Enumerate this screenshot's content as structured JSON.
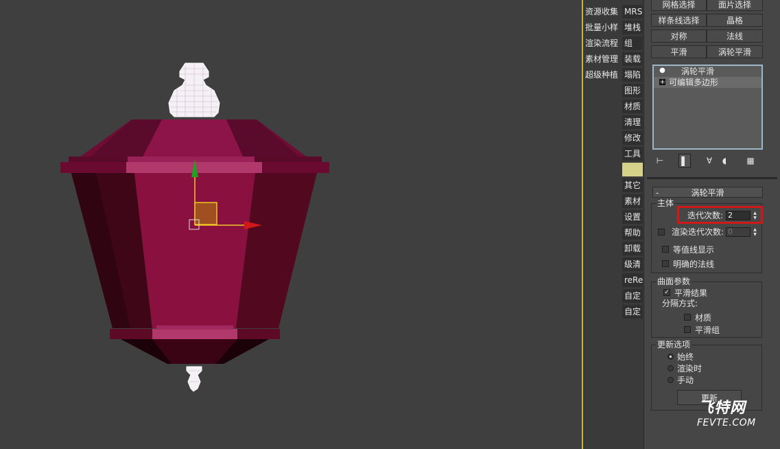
{
  "colors": {
    "viewport_bg": "#3f3f3f",
    "panel_bg": "#464646",
    "accent_highlight": "#d01818",
    "lamp_main": "#8a1040",
    "lamp_dark": "#4a0820",
    "lamp_light": "#b03060",
    "gizmo_x": "#d01818",
    "gizmo_y": "#20a020",
    "gizmo_center": "#a05020",
    "mesh_white": "#ffffff"
  },
  "script_menu": {
    "items": [
      "资源收集",
      "批量小样",
      "渲染流程",
      "素材管理",
      "超级种植"
    ]
  },
  "tool_menu": {
    "items": [
      "MRS",
      "堆栈",
      "组",
      "装载",
      "塌陷",
      "图形",
      "材质",
      "清理",
      "修改",
      "工具",
      "",
      "其它",
      "素材",
      "设置",
      "帮助",
      "卸载",
      "级清",
      "reRe",
      "自定",
      "自定"
    ]
  },
  "modifier_buttons": [
    [
      "网格选择",
      "面片选择"
    ],
    [
      "样条线选择",
      "晶格"
    ],
    [
      "对称",
      "法线"
    ],
    [
      "平滑",
      "涡轮平滑"
    ]
  ],
  "modifier_stack": {
    "items": [
      {
        "label": "涡轮平滑",
        "icon": "lightbulb-icon"
      },
      {
        "label": "可编辑多边形",
        "icon": "plus-box-icon"
      }
    ]
  },
  "stack_toolbar": {
    "icons": [
      "pin-stack-icon",
      "show-end-result-icon",
      "make-unique-icon",
      "remove-modifier-icon",
      "configure-sets-icon"
    ]
  },
  "rollout": {
    "title": "涡轮平滑",
    "collapse_symbol": "-",
    "main_group": {
      "title": "主体",
      "iterations_label": "迭代次数:",
      "iterations_value": "2",
      "render_iters_label": "渲染迭代次数:",
      "render_iters_value": "0",
      "isoline_label": "等值线显示",
      "explicit_normals_label": "明确的法线"
    },
    "surface_group": {
      "title": "曲面参数",
      "smooth_result_label": "平滑结果",
      "smooth_result_checked": true,
      "separate_by_label": "分隔方式:",
      "materials_label": "材质",
      "smoothing_groups_label": "平滑组"
    },
    "update_group": {
      "title": "更新选项",
      "options": [
        "始终",
        "渲染时",
        "手动"
      ],
      "selected_index": 0,
      "update_button": "更新"
    }
  },
  "watermark": {
    "main": "飞特网",
    "sub": "FEVTE.COM"
  }
}
